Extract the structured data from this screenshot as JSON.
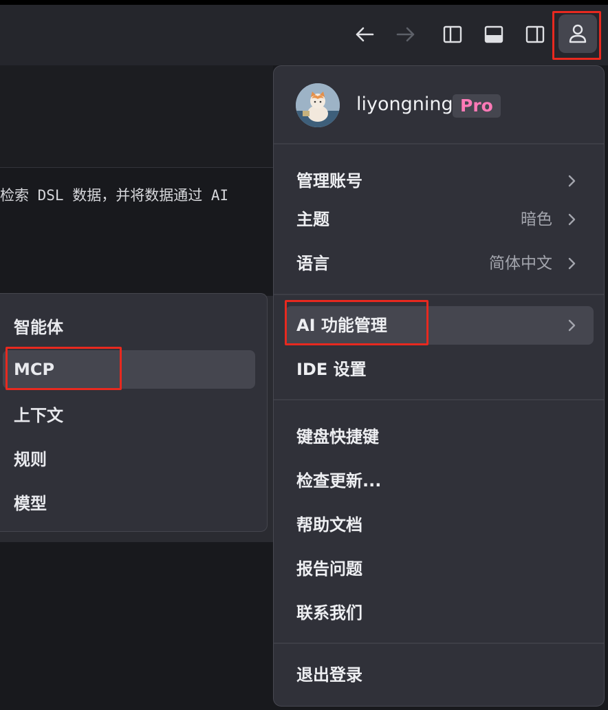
{
  "toolbar": {
    "back_icon": "arrow-left-icon",
    "forward_icon": "arrow-right-icon",
    "sidebar_left_icon": "toggle-left-panel-icon",
    "panel_bottom_icon": "toggle-bottom-panel-icon",
    "sidebar_right_icon": "toggle-right-panel-icon",
    "user_icon": "user-icon"
  },
  "editor": {
    "code_line": "检索 DSL 数据，并将数据通过 AI"
  },
  "profile": {
    "username": "liyongning",
    "badge": "Pro"
  },
  "menu": {
    "account": {
      "label": "管理账号"
    },
    "theme": {
      "label": "主题",
      "value": "暗色"
    },
    "language": {
      "label": "语言",
      "value": "简体中文"
    },
    "ai": {
      "label": "AI 功能管理"
    },
    "ide": {
      "label": "IDE 设置"
    },
    "shortcuts": {
      "label": "键盘快捷键"
    },
    "updates": {
      "label": "检查更新..."
    },
    "docs": {
      "label": "帮助文档"
    },
    "report": {
      "label": "报告问题"
    },
    "contact": {
      "label": "联系我们"
    },
    "logout": {
      "label": "退出登录"
    }
  },
  "submenu": {
    "items": [
      {
        "label": "智能体"
      },
      {
        "label": "MCP"
      },
      {
        "label": "上下文"
      },
      {
        "label": "规则"
      },
      {
        "label": "模型"
      }
    ]
  },
  "colors": {
    "highlight_border": "#e8291f",
    "pro_badge_text": "#ff7ab7",
    "menu_bg": "#303139",
    "active_item_bg": "#45464f"
  }
}
